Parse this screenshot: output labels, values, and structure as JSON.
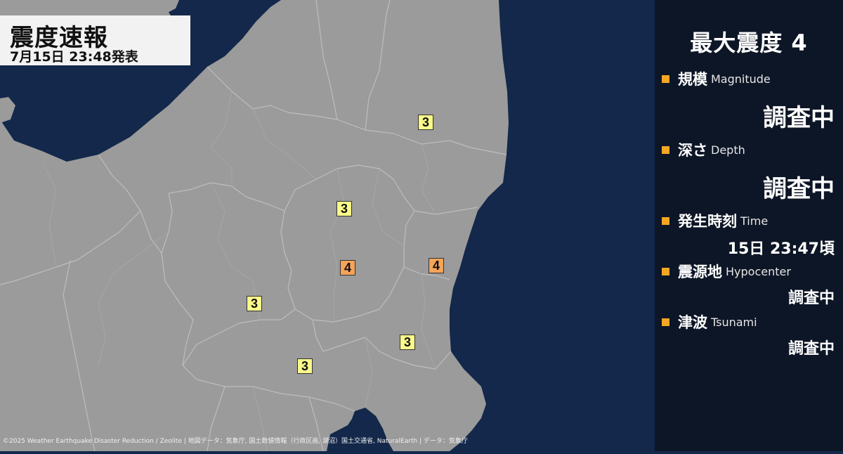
{
  "header": {
    "title": "震度速報",
    "subtitle": "7月15日 23:48発表"
  },
  "map": {
    "markers": [
      {
        "intensity": "3"
      },
      {
        "intensity": "3"
      },
      {
        "intensity": "4"
      },
      {
        "intensity": "4"
      },
      {
        "intensity": "3"
      },
      {
        "intensity": "3"
      },
      {
        "intensity": "3"
      }
    ],
    "credit": "©2025 Weather Earthquake Disaster Reduction / Zeolite | 地図データ：気象庁, 国土数値情報（行政区画, 湖沼）国土交通省, NaturalEarth | データ：気象庁"
  },
  "panel": {
    "max_intensity": "最大震度 4",
    "magnitude": {
      "label_ja": "規模",
      "label_en": "Magnitude",
      "value": "調査中"
    },
    "depth": {
      "label_ja": "深さ",
      "label_en": "Depth",
      "value": "調査中"
    },
    "time": {
      "label_ja": "発生時刻",
      "label_en": "Time",
      "value": "15日 23:47頃"
    },
    "hypocenter": {
      "label_ja": "震源地",
      "label_en": "Hypocenter",
      "value": "調査中"
    },
    "tsunami": {
      "label_ja": "津波",
      "label_en": "Tsunami",
      "value": "調査中"
    }
  },
  "colors": {
    "sea": "#13284a",
    "land": "#9b9b9b",
    "border": "#b9b9b9",
    "panel": "#0d1626",
    "bullet": "#f5a623",
    "intensity_3": "#fafa8a",
    "intensity_4": "#f5a45a"
  }
}
